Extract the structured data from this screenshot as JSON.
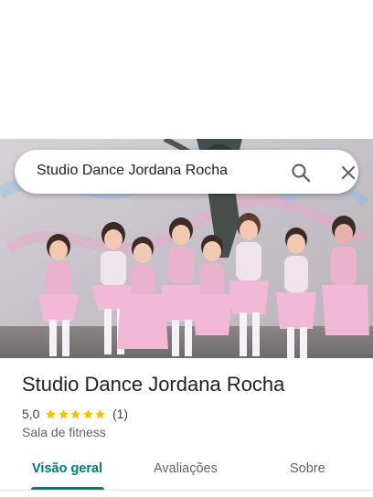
{
  "search": {
    "query": "Studio Dance Jordana Rocha"
  },
  "place": {
    "name": "Studio Dance Jordana Rocha",
    "rating": "5,0",
    "rating_stars": 5,
    "review_count": "(1)",
    "category": "Sala de fitness"
  },
  "tabs": [
    {
      "label": "Visão geral",
      "active": true
    },
    {
      "label": "Avaliações",
      "active": false
    },
    {
      "label": "Sobre",
      "active": false
    }
  ],
  "colors": {
    "accent": "#01796f",
    "star": "#fbbc04"
  },
  "icons": {
    "search": "search-icon",
    "close": "close-icon",
    "star": "star-icon"
  }
}
